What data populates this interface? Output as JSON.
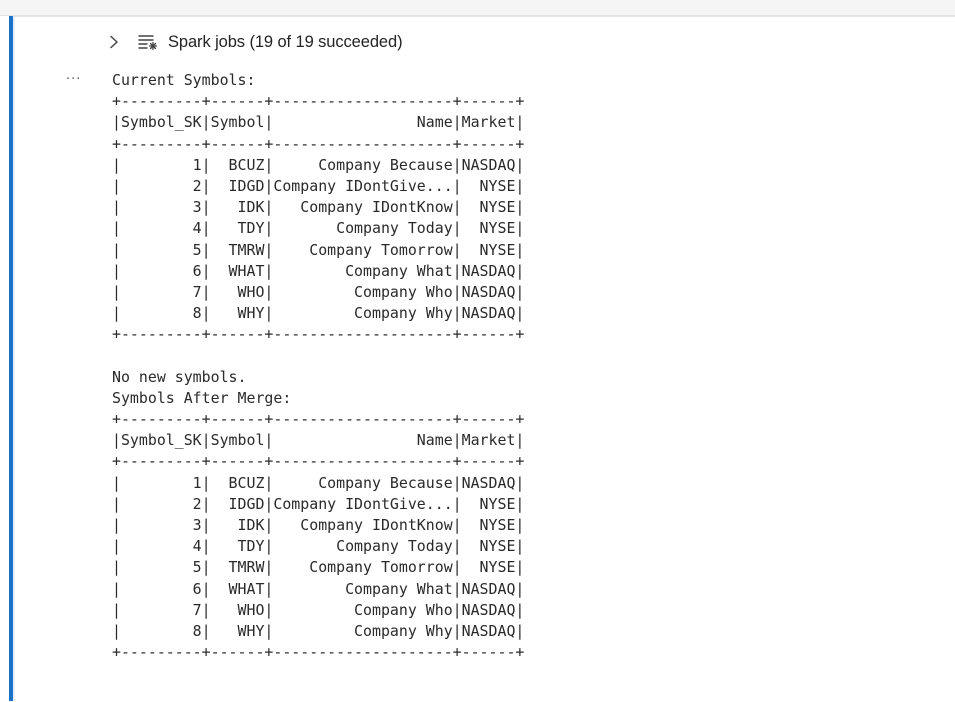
{
  "spark_jobs": {
    "label": "Spark jobs (19 of 19 succeeded)",
    "expand_icon": "chevron-right-icon",
    "list_icon": "spark-jobs-list-icon"
  },
  "more_actions": "···",
  "output_lines": [
    "Current Symbols:",
    "+---------+------+--------------------+------+",
    "|Symbol_SK|Symbol|                Name|Market|",
    "+---------+------+--------------------+------+",
    "|        1|  BCUZ|     Company Because|NASDAQ|",
    "|        2|  IDGD|Company IDontGive...|  NYSE|",
    "|        3|   IDK|   Company IDontKnow|  NYSE|",
    "|        4|   TDY|       Company Today|  NYSE|",
    "|        5|  TMRW|    Company Tomorrow|  NYSE|",
    "|        6|  WHAT|        Company What|NASDAQ|",
    "|        7|   WHO|         Company Who|NASDAQ|",
    "|        8|   WHY|         Company Why|NASDAQ|",
    "+---------+------+--------------------+------+",
    "",
    "No new symbols.",
    "Symbols After Merge:",
    "+---------+------+--------------------+------+",
    "|Symbol_SK|Symbol|                Name|Market|",
    "+---------+------+--------------------+------+",
    "|        1|  BCUZ|     Company Because|NASDAQ|",
    "|        2|  IDGD|Company IDontGive...|  NYSE|",
    "|        3|   IDK|   Company IDontKnow|  NYSE|",
    "|        4|   TDY|       Company Today|  NYSE|",
    "|        5|  TMRW|    Company Tomorrow|  NYSE|",
    "|        6|  WHAT|        Company What|NASDAQ|",
    "|        7|   WHO|         Company Who|NASDAQ|",
    "|        8|   WHY|         Company Why|NASDAQ|",
    "+---------+------+--------------------+------+"
  ]
}
